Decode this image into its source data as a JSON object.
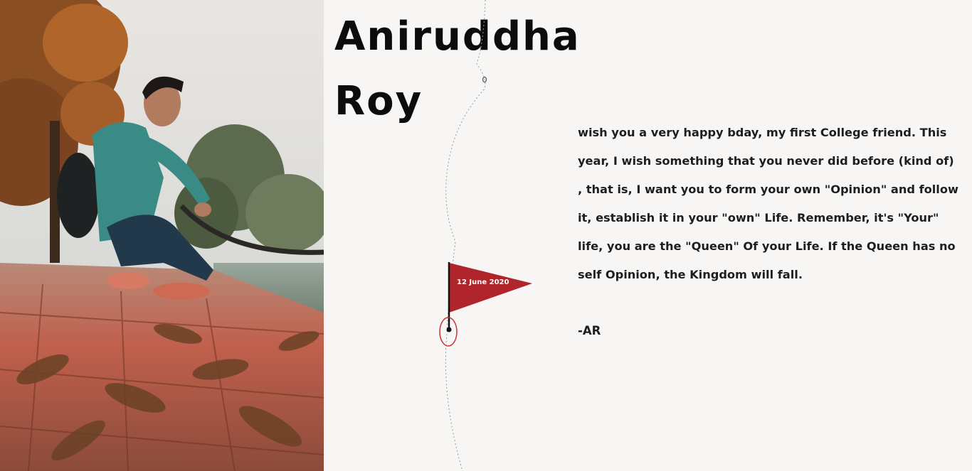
{
  "profile": {
    "first_name": "Aniruddha",
    "last_name": "Roy"
  },
  "flag": {
    "date": "12 June 2020",
    "color": "#b0242b",
    "pin_ring_color": "#c9343a"
  },
  "message": {
    "text": "wish you a very happy bday, my first College friend. This year, I wish something that you never did before (kind of) , that is, I want you to form your own \"Opinion\" and follow it, establish it in your \"own\" Life. Remember, it's \"Your\" life, you are the \"Queen\" Of your Life. If the Queen has no self Opinion, the Kingdom will fall.",
    "signature": "-AR"
  },
  "photo": {
    "alt_icon": "portrait-photo"
  }
}
